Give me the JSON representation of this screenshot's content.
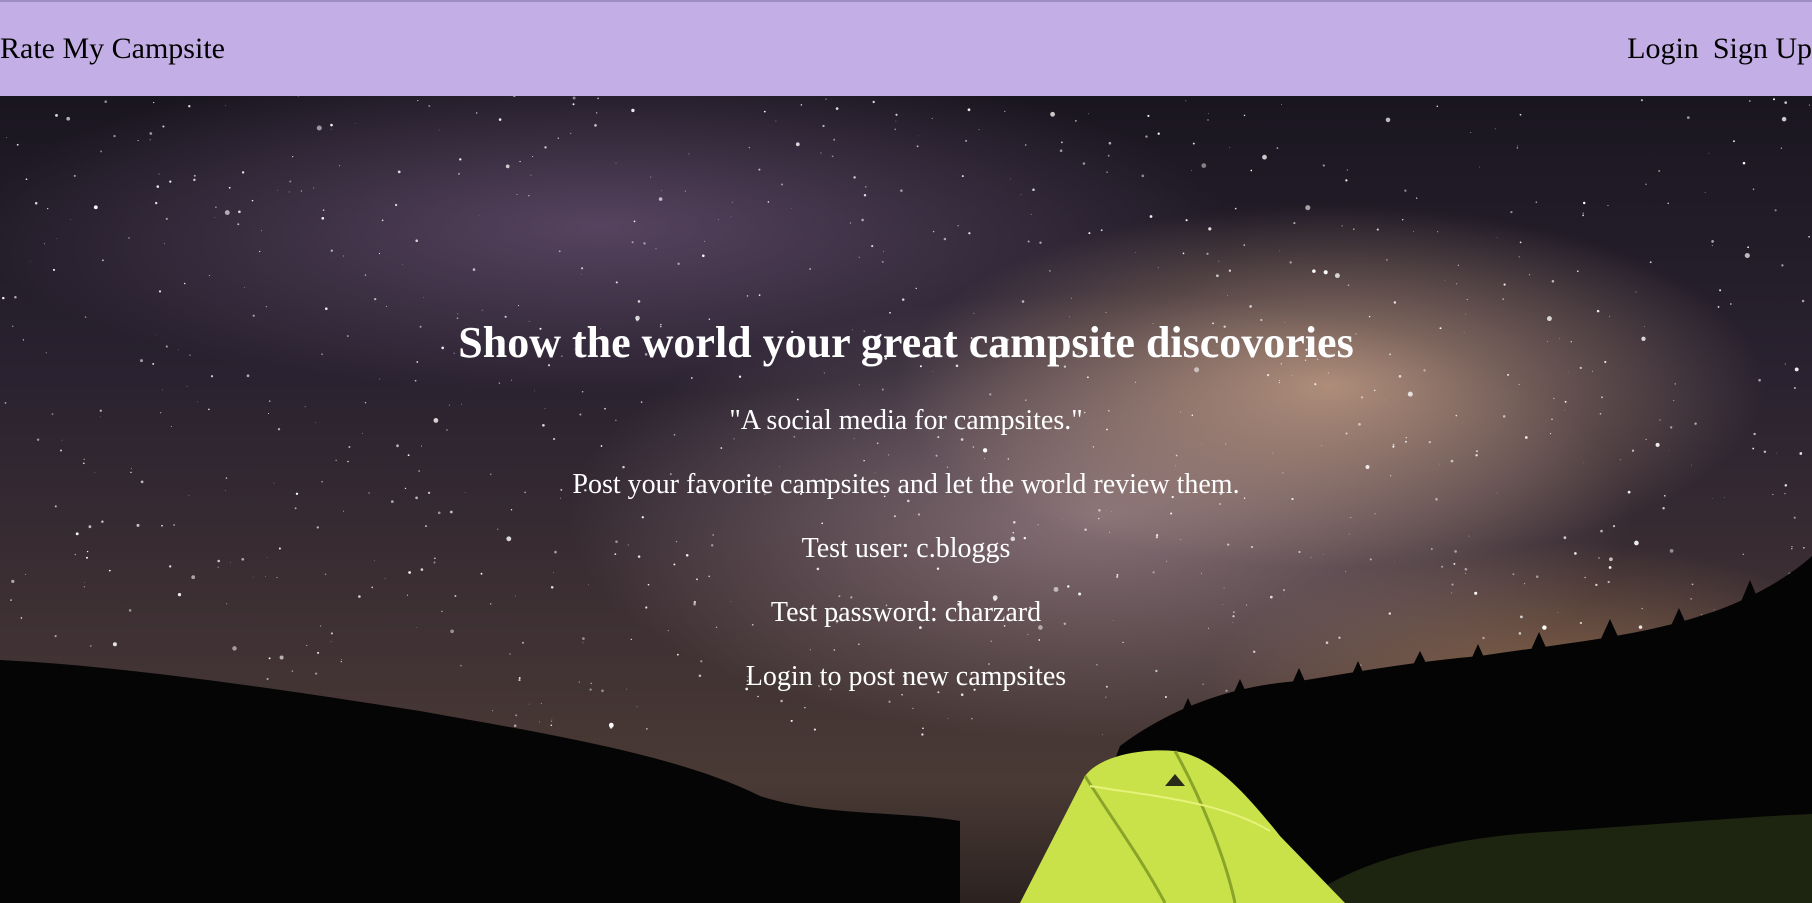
{
  "navbar": {
    "brand": "Rate My Campsite",
    "login": "Login",
    "signup": "Sign Up",
    "background_color": "#c3afe6"
  },
  "hero": {
    "title": "Show the world your great campsite discovories",
    "tagline": "\"A social media for campsites.\"",
    "description": "Post your favorite campsites and let the world review them.",
    "test_user": "Test user: c.bloggs",
    "test_password": "Test password: charzard",
    "cta": "Login to post new campsites",
    "background_image": "night-sky-milky-way-with-lit-tent"
  }
}
